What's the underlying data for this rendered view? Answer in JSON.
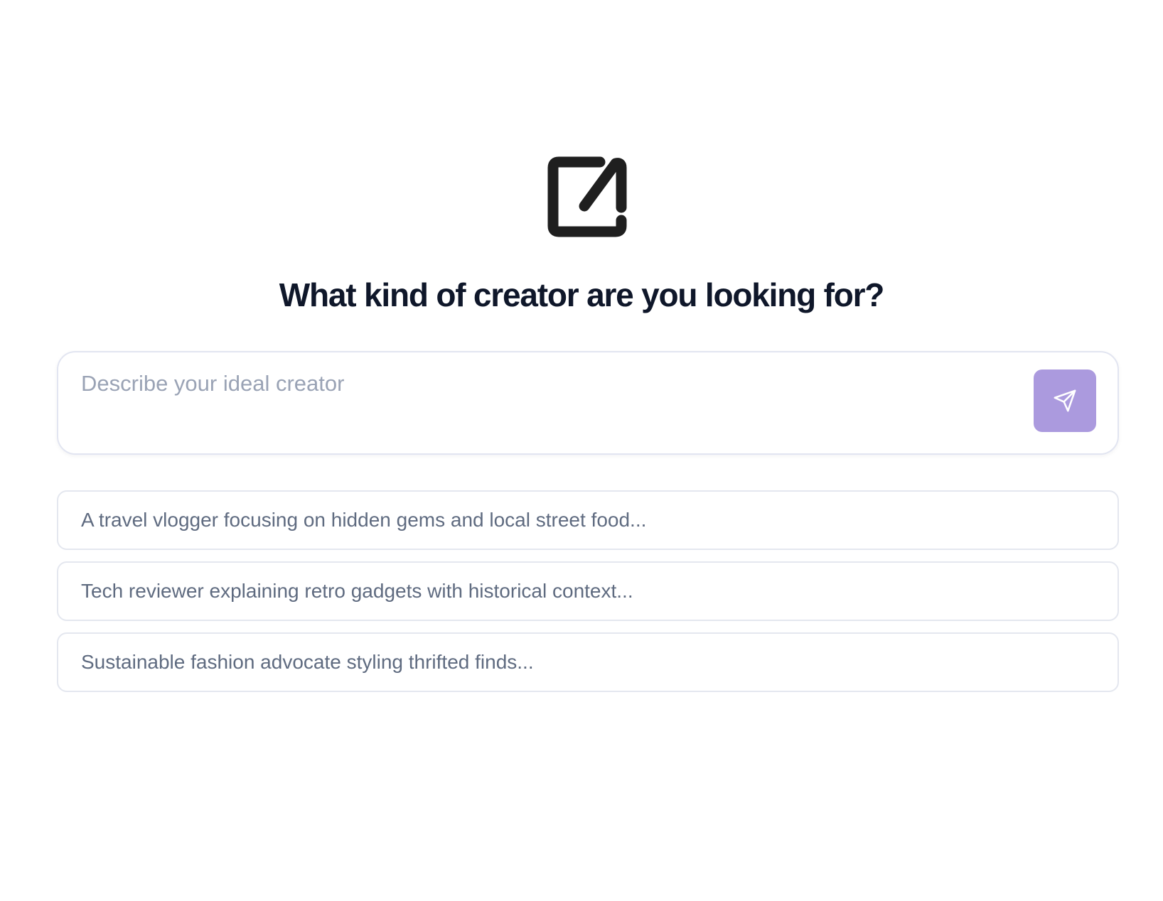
{
  "logo": {
    "icon": "edit-square-icon",
    "color": "#1f1f1f"
  },
  "headline": "What kind of creator are you looking for?",
  "composer": {
    "placeholder": "Describe your ideal creator",
    "value": "",
    "send_icon": "send-icon",
    "send_button_color": "#ab9ade"
  },
  "suggestions": [
    {
      "text": "A travel vlogger focusing on hidden gems and local street food..."
    },
    {
      "text": "Tech reviewer explaining retro gadgets with historical context..."
    },
    {
      "text": "Sustainable fashion advocate styling thrifted finds..."
    }
  ],
  "colors": {
    "heading": "#0f172a",
    "placeholder": "#9aa3b5",
    "suggestion_text": "#5f6b80",
    "border": "#e2e5f1"
  }
}
